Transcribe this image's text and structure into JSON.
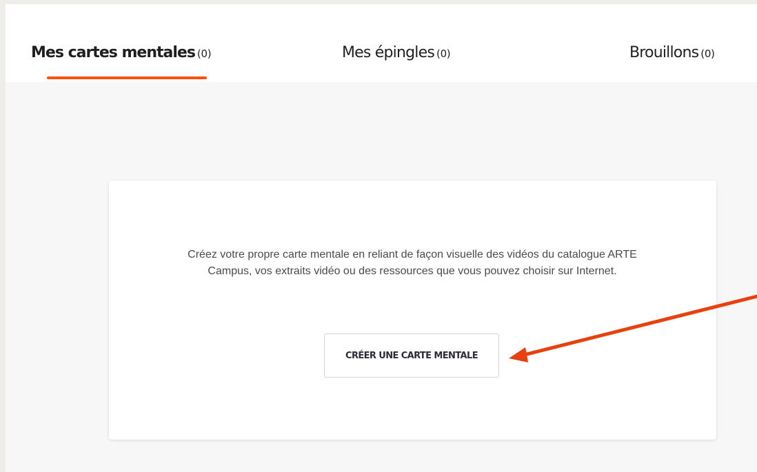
{
  "tabs": [
    {
      "label": "Mes cartes mentales",
      "count": "(0)",
      "active": true
    },
    {
      "label": "Mes épingles",
      "count": "(0)",
      "active": false
    },
    {
      "label": "Brouillons",
      "count": "(0)",
      "active": false
    }
  ],
  "empty_state": {
    "description": "Créez votre propre carte mentale en reliant de façon visuelle des vidéos du catalogue ARTE Campus, vos extraits vidéo ou des ressources que vous pouvez choisir sur Internet.",
    "button_label": "CRÉER UNE CARTE MENTALE"
  },
  "colors": {
    "accent": "#ff4f0f",
    "annotation_arrow": "#e8400e",
    "page_background": "#f7f7f7",
    "card_background": "#ffffff",
    "text": "#4a4a4a"
  }
}
